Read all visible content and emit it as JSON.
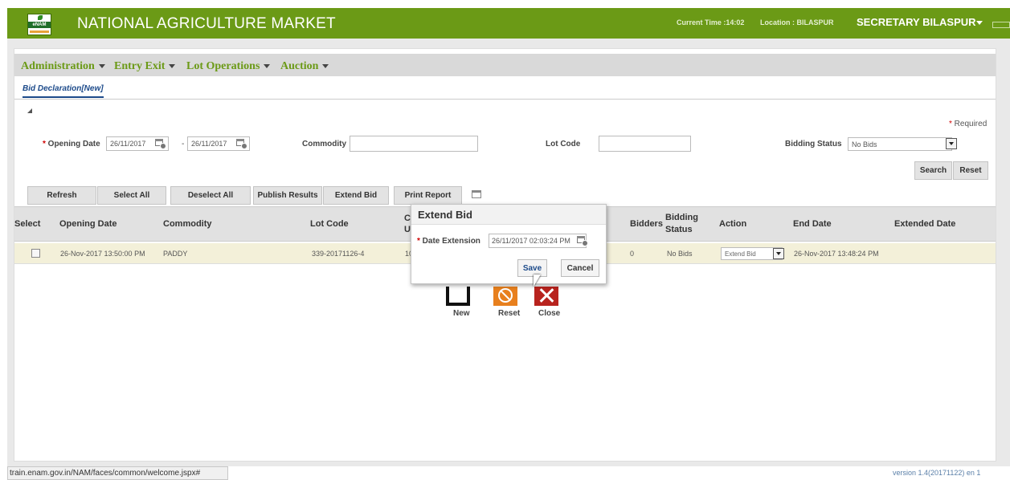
{
  "header": {
    "logo_text": "eNAM",
    "title": "NATIONAL AGRICULTURE MARKET",
    "current_time": "Current Time :14:02",
    "location": "Location : BILASPUR",
    "user": "SECRETARY BILASPUR",
    "accent": "#6b9a16"
  },
  "menu": [
    "Administration",
    "Entry Exit",
    "Lot Operations",
    "Auction"
  ],
  "page_tab": "Bid Declaration[New]",
  "filters": {
    "required": "Required",
    "opening_date_label": "Opening Date",
    "date_from": "26/11/2017",
    "date_sep": "-",
    "date_to": "26/11/2017",
    "commodity_label": "Commodity",
    "commodity_value": "",
    "lot_code_label": "Lot Code",
    "lot_code_value": "",
    "bidding_status_label": "Bidding Status",
    "bidding_status_value": "No Bids",
    "search": "Search",
    "reset": "Reset"
  },
  "toolbar": [
    "Refresh",
    "Select All",
    "Deselect All",
    "Publish Results",
    "Extend Bid",
    "Print Report"
  ],
  "table": {
    "headers": {
      "select": "Select",
      "opening_date": "Opening Date",
      "commodity": "Commodity",
      "lot_code": "Lot Code",
      "col5_a": "C",
      "col5_b": "U",
      "bidders": "Bidders",
      "bidding_status_a": "Bidding",
      "bidding_status_b": "Status",
      "action": "Action",
      "end_date": "End Date",
      "extended_date": "Extended Date"
    },
    "row": {
      "opening_date": "26-Nov-2017 13:50:00 PM",
      "commodity": "PADDY",
      "lot_code": "339-20171126-4",
      "col5": "10",
      "bidders": "0",
      "bidding_status": "No Bids",
      "action": "Extend Bid",
      "end_date": "26-Nov-2017 13:48:24 PM",
      "extended_date": ""
    }
  },
  "bottom_buttons": [
    "New",
    "Reset",
    "Close"
  ],
  "dialog": {
    "title": "Extend Bid",
    "label": "Date Extension",
    "value": "26/11/2017 02:03:24 PM",
    "save": "Save",
    "cancel": "Cancel"
  },
  "status_url": "train.enam.gov.in/NAM/faces/common/welcome.jspx#",
  "version": "version 1.4(20171122)   en   1"
}
